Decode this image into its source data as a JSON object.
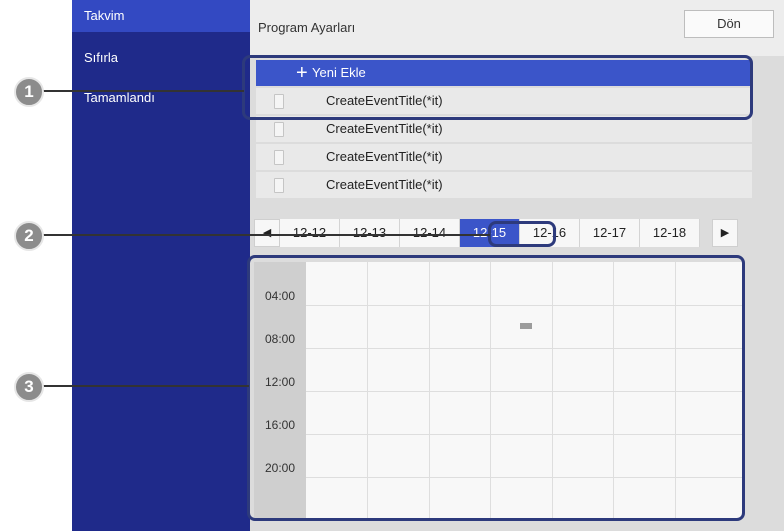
{
  "sidebar": {
    "items": [
      {
        "label": "Takvim",
        "active": true
      },
      {
        "label": "Sıfırla",
        "active": false
      },
      {
        "label": "Tamamlandı",
        "active": false
      }
    ]
  },
  "header": {
    "title": "Program Ayarları",
    "back_label": "Dön"
  },
  "events": {
    "add_label": "Yeni Ekle",
    "add_icon": "+",
    "items": [
      "CreateEventTitle(*it)",
      "CreateEventTitle(*it)",
      "CreateEventTitle(*it)",
      "CreateEventTitle(*it)"
    ]
  },
  "dates": {
    "prev_icon": "◀",
    "next_icon": "▶",
    "tabs": [
      "12-12",
      "12-13",
      "12-14",
      "12-15",
      "12-16",
      "12-17",
      "12-18"
    ],
    "selected": "12-15"
  },
  "timeline": {
    "times": [
      "04:00",
      "08:00",
      "12:00",
      "16:00",
      "20:00"
    ]
  },
  "callouts": [
    "1",
    "2",
    "3"
  ],
  "colors": {
    "sidebar": "#1f2a8a",
    "accent": "#3b55c9",
    "callout": "#8c8c8c"
  }
}
